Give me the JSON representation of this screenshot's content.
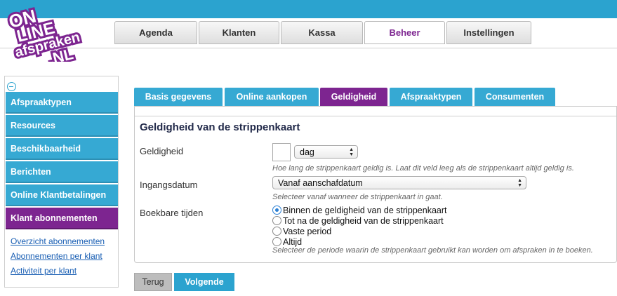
{
  "logo": {
    "text_line1": "ON",
    "text_line2": "LINE",
    "text_line3": "afspraken",
    "text_line4": ".NL",
    "colors": {
      "purple": "#7d2590",
      "white": "#ffffff"
    }
  },
  "main_tabs": [
    {
      "label": "Agenda"
    },
    {
      "label": "Klanten"
    },
    {
      "label": "Kassa"
    },
    {
      "label": "Beheer",
      "active": true
    },
    {
      "label": "Instellingen"
    }
  ],
  "sidebar": {
    "collapse_icon": "minus-circle-icon",
    "items": [
      {
        "label": "Afspraaktypen"
      },
      {
        "label": "Resources"
      },
      {
        "label": "Beschikbaarheid"
      },
      {
        "label": "Berichten"
      },
      {
        "label": "Online Klantbetalingen"
      },
      {
        "label": "Klant abonnementen",
        "active": true
      }
    ],
    "links": [
      {
        "label": "Overzicht abonnementen"
      },
      {
        "label": "Abonnementen per klant"
      },
      {
        "label": "Activiteit per klant"
      }
    ]
  },
  "sub_tabs": [
    {
      "label": "Basis gegevens"
    },
    {
      "label": "Online aankopen"
    },
    {
      "label": "Geldigheid",
      "active": true
    },
    {
      "label": "Afspraaktypen"
    },
    {
      "label": "Consumenten"
    }
  ],
  "form": {
    "title": "Geldigheid van de strippenkaart",
    "geldigheid": {
      "label": "Geldigheid",
      "value": "",
      "unit_selected": "dag",
      "hint": "Hoe lang de strippenkaart geldig is. Laat dit veld leeg als de strippenkaart altijd geldig is."
    },
    "ingangsdatum": {
      "label": "Ingangsdatum",
      "selected": "Vanaf aanschafdatum",
      "hint": "Selecteer vanaf wanneer de strippenkaart in gaat."
    },
    "boekbare_tijden": {
      "label": "Boekbare tijden",
      "options": [
        {
          "label": "Binnen de geldigheid van de strippenkaart",
          "checked": true
        },
        {
          "label": "Tot na de geldigheid van de strippenkaart",
          "checked": false
        },
        {
          "label": "Vaste period",
          "checked": false
        },
        {
          "label": "Altijd",
          "checked": false
        }
      ],
      "hint": "Selecteer de periode waarin de strippenkaart gebruikt kan worden om afspraken in te boeken."
    }
  },
  "buttons": {
    "back": "Terug",
    "next": "Volgende"
  },
  "colors": {
    "blue": "#2ba3cf",
    "purple": "#7d2590",
    "link": "#1a5fb4"
  }
}
